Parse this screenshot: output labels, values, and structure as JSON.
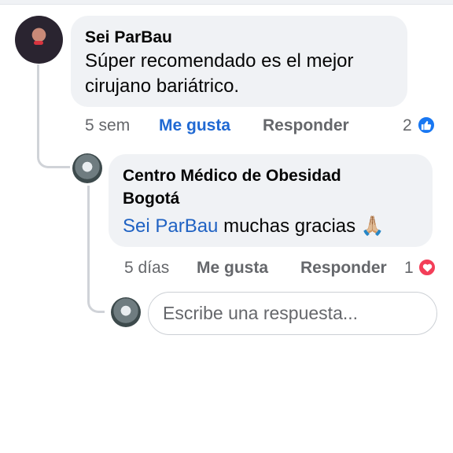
{
  "comment": {
    "author": "Sei ParBau",
    "text_line1": "Súper recomendado es el mejor",
    "text_line2": "cirujano bariátrico.",
    "time": "5 sem",
    "like_label": "Me gusta",
    "reply_label": "Responder",
    "reaction_count": "2",
    "reaction_icon": "like-icon",
    "reaction_color": "#1877f2"
  },
  "reply": {
    "author_line1": "Centro Médico de Obesidad",
    "author_line2": "Bogotá",
    "mention": "Sei ParBau",
    "text": " muchas gracias ",
    "emoji": "🙏🏼",
    "time": "5 días",
    "like_label": "Me gusta",
    "reply_label": "Responder",
    "reaction_count": "1",
    "reaction_icon": "heart-icon",
    "reaction_color": "#f33e58"
  },
  "compose": {
    "placeholder": "Escribe una respuesta..."
  },
  "colors": {
    "link_blue": "#1f62c3",
    "bubble_bg": "#f0f2f5",
    "meta_gray": "#65676b"
  }
}
